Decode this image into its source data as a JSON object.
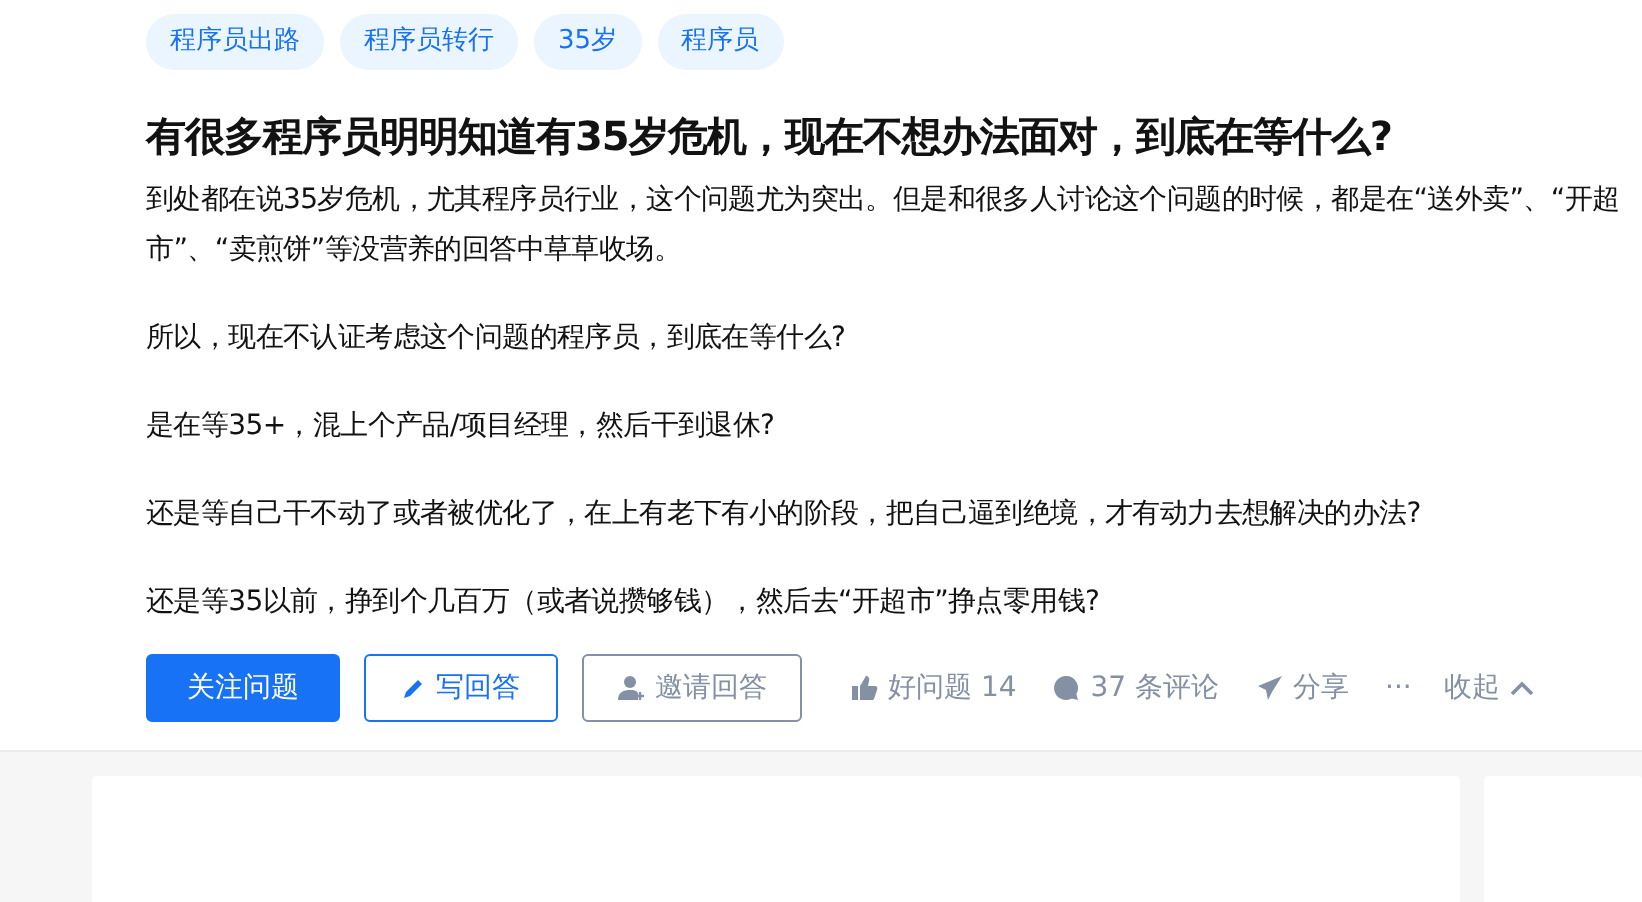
{
  "tags": [
    "程序员出路",
    "程序员转行",
    "35岁",
    "程序员"
  ],
  "title": "有很多程序员明明知道有35岁危机，现在不想办法面对，到底在等什么?",
  "paragraphs": [
    "到处都在说35岁危机，尤其程序员行业，这个问题尤为突出。但是和很多人讨论这个问题的时候，都是在“送外卖”、“开超市”、“卖煎饼”等没营养的回答中草草收场。",
    "所以，现在不认证考虑这个问题的程序员，到底在等什么?",
    "是在等35+，混上个产品/项目经理，然后干到退休?",
    "还是等自己干不动了或者被优化了，在上有老下有小的阶段，把自己逼到绝境，才有动力去想解决的办法?",
    "还是等35以前，挣到个几百万（或者说攒够钱），然后去“开超市”挣点零用钱?"
  ],
  "buttons": [
    {
      "kind": "primary",
      "label": "关注问题"
    },
    {
      "kind": "outline",
      "label": "写回答"
    },
    {
      "kind": "ghost",
      "label": "邀请回答"
    }
  ],
  "actions": [
    {
      "kind": "like",
      "label": "好问题 14"
    },
    {
      "kind": "comment",
      "label": "37 条评论"
    },
    {
      "kind": "share",
      "label": "分享"
    },
    {
      "kind": "more",
      "label": "···"
    },
    {
      "kind": "collapse",
      "label": "收起"
    }
  ]
}
